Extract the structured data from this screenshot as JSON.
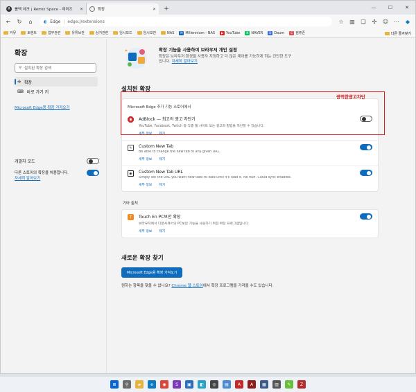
{
  "tabs": [
    {
      "title": "롤백 체크 | Remix Space - 레미즈",
      "active": false
    },
    {
      "title": "확장",
      "active": true
    }
  ],
  "address": {
    "brand": "Edge",
    "url": "edge://extensions"
  },
  "bookmarks": [
    {
      "label": "커뮤",
      "kind": "folder"
    },
    {
      "label": "토렌트",
      "kind": "folder"
    },
    {
      "label": "업무관련",
      "kind": "folder"
    },
    {
      "label": "유튜브관",
      "kind": "folder"
    },
    {
      "label": "상거관련",
      "kind": "folder"
    },
    {
      "label": "임시모드",
      "kind": "folder"
    },
    {
      "label": "임시보관",
      "kind": "folder"
    },
    {
      "label": "NAS",
      "kind": "folder"
    },
    {
      "label": "Millennium - NAS",
      "kind": "icon",
      "color": "#1565c0",
      "glyph": "M"
    },
    {
      "label": "YouTube",
      "kind": "icon",
      "color": "#e62117",
      "glyph": "▶"
    },
    {
      "label": "NAVER",
      "kind": "icon",
      "color": "#03c75a",
      "glyph": "N"
    },
    {
      "label": "Daum",
      "kind": "icon",
      "color": "#3b6ce2",
      "glyph": "D"
    },
    {
      "label": "컴퓨존",
      "kind": "icon",
      "color": "#d9534f",
      "glyph": "C"
    }
  ],
  "bookmarks_other": "다른 즐겨찾기",
  "sidebar": {
    "title": "확장",
    "search_placeholder": "설치된 확장 검색",
    "items": [
      {
        "label": "확장",
        "selected": true
      },
      {
        "label": "바로 가기 키",
        "selected": false
      }
    ],
    "store_link": "Microsoft Edge용 확장 가져오기",
    "dev_mode_label": "개발자 모드",
    "dev_mode_on": false,
    "other_sources_label": "다른 스토어의 확장을 허용합니다.",
    "other_sources_link": "자세히 알아보기",
    "other_sources_on": true
  },
  "banner": {
    "title": "확장 기능을 사용하여 브라우저 개인 설정",
    "desc_line1": "확장은 브라우저 환경을 사용자 지정하고 더 많은 제어를 가능하게 하는 간단한 도구",
    "desc_line2_prefix": "입니다. ",
    "desc_link": "자세히 알아보기"
  },
  "installed": {
    "title": "설치된 확장",
    "store_subheading": "Microsoft Edge 추가 기능 스토어에서",
    "extensions": [
      {
        "name": "AdBlock — 최고의 광고 차단기",
        "desc": "YouTube, Facebook, Twitch 등 각종 웹 사이트 또는 광고와 팝업을 차단할 수 있습니다.",
        "details": "세부 정보",
        "remove": "제거",
        "enabled": false,
        "icon_color": "#d12b2b",
        "icon": "adblock-icon"
      },
      {
        "name": "Custom New Tab",
        "desc": "Be able to change the new tab to any given URL.",
        "details": "세부 정보",
        "remove": "제거",
        "enabled": true,
        "icon_color": "#444",
        "icon": "custom-new-tab-icon"
      },
      {
        "name": "Custom New Tab URL",
        "desc": "Simply set the URL you want new tabs to load until it'll load it. No fluff. Cloud sync enabled.",
        "details": "세부 정보",
        "remove": "제거",
        "enabled": true,
        "icon_color": "#222",
        "icon": "custom-new-tab-url-icon"
      }
    ],
    "other_subheading": "기타 출처",
    "other_extensions": [
      {
        "name": "Touch En PC보안 확장",
        "desc": "브라우저에서 다운시큐어의 PC보안 기능을 사용하기 위한 확장 프로그램입니다.",
        "details": "세부 정보",
        "remove": "제거",
        "enabled": true,
        "icon_color": "#f08a24",
        "icon": "touchen-icon"
      }
    ]
  },
  "annotation": {
    "label": "광력한광고차단",
    "color": "#d42020"
  },
  "find": {
    "title": "새로운 확장 찾기",
    "button": "Microsoft Edge용 확장 가져오기",
    "text_prefix": "원하는 항목을 찾을 수 없나요? ",
    "text_link": "Chrome 웹 스토어",
    "text_suffix": "에서 확장 프로그램을 가져올 수도 있습니다."
  },
  "taskbar_icons": [
    {
      "name": "windows-start-icon",
      "color": "#0a64d8",
      "glyph": "⊞"
    },
    {
      "name": "search-icon",
      "color": "#6b6b6b",
      "glyph": "⚲"
    },
    {
      "name": "file-explorer-icon",
      "color": "#e8b43c",
      "glyph": "▰"
    },
    {
      "name": "edge-icon",
      "color": "#0e7ac4",
      "glyph": "e"
    },
    {
      "name": "chrome-icon",
      "color": "#db4437",
      "glyph": "◉"
    },
    {
      "name": "app-s-icon",
      "color": "#7b3ab8",
      "glyph": "S"
    },
    {
      "name": "remote-desktop-icon",
      "color": "#2a6fbf",
      "glyph": "▣"
    },
    {
      "name": "app-store-icon",
      "color": "#27a0c8",
      "glyph": "◧"
    },
    {
      "name": "photos-icon",
      "color": "#444",
      "glyph": "◎"
    },
    {
      "name": "gallery-icon",
      "color": "#4b8bd0",
      "glyph": "▤"
    },
    {
      "name": "pdf-icon",
      "color": "#c62828",
      "glyph": "A"
    },
    {
      "name": "acrobat-icon",
      "color": "#8e1d1d",
      "glyph": "A"
    },
    {
      "name": "zip-icon",
      "color": "#3a5a8c",
      "glyph": "▦"
    },
    {
      "name": "winrar-icon",
      "color": "#555",
      "glyph": "▥"
    },
    {
      "name": "notepad-plus-icon",
      "color": "#6abf3a",
      "glyph": "✎"
    },
    {
      "name": "filezilla-icon",
      "color": "#b32d2d",
      "glyph": "Z"
    }
  ]
}
